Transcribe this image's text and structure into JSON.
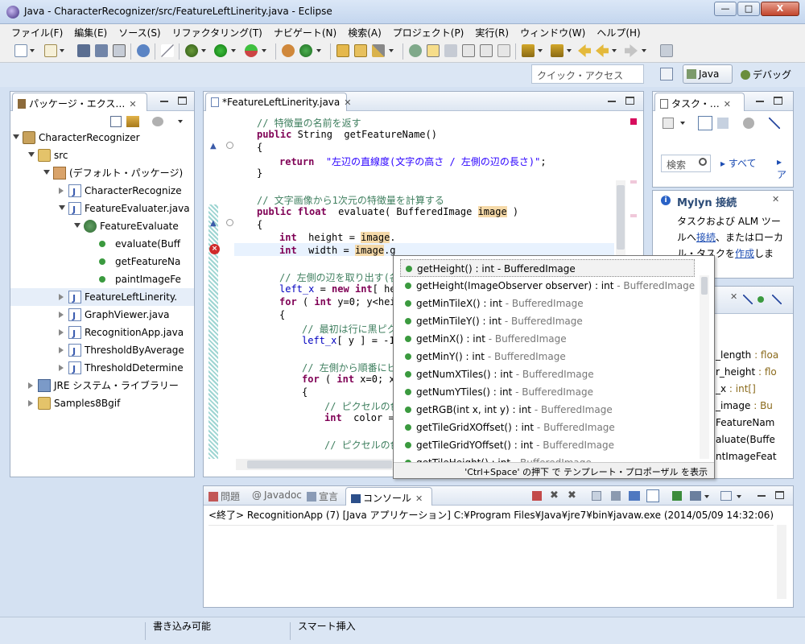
{
  "window": {
    "title": "Java - CharacterRecognizer/src/FeatureLeftLinerity.java - Eclipse",
    "min_btn": "—",
    "max_btn": "□",
    "close_btn": "X"
  },
  "menu": [
    "ファイル(F)",
    "編集(E)",
    "ソース(S)",
    "リファクタリング(T)",
    "ナビゲート(N)",
    "検索(A)",
    "プロジェクト(P)",
    "実行(R)",
    "ウィンドウ(W)",
    "ヘルプ(H)"
  ],
  "toolbar": {
    "quick_access": "クイック・アクセス",
    "perspective_java": "Java",
    "perspective_debug": "デバッグ"
  },
  "package_explorer": {
    "tab": "パッケージ・エクス…",
    "close": "✕",
    "tree": [
      {
        "label": "CharacterRecognizer",
        "type": "proj"
      },
      {
        "label": "src",
        "type": "folder"
      },
      {
        "label": "(デフォルト・パッケージ)",
        "type": "pkg"
      },
      {
        "label": "CharacterRecognize",
        "type": "file"
      },
      {
        "label": "FeatureEvaluater.java",
        "type": "file"
      },
      {
        "label": "FeatureEvaluate",
        "type": "class"
      },
      {
        "label": "evaluate(Buff",
        "type": "method"
      },
      {
        "label": "getFeatureNa",
        "type": "method"
      },
      {
        "label": "paintImageFe",
        "type": "method"
      },
      {
        "label": "FeatureLeftLinerity.",
        "type": "file"
      },
      {
        "label": "GraphViewer.java",
        "type": "file"
      },
      {
        "label": "RecognitionApp.java",
        "type": "file"
      },
      {
        "label": "ThresholdByAverage",
        "type": "file"
      },
      {
        "label": "ThresholdDetermine",
        "type": "file"
      },
      {
        "label": "JRE システム・ライブラリー",
        "type": "lib"
      },
      {
        "label": "Samples8Bgif",
        "type": "folder"
      }
    ]
  },
  "editor": {
    "tab": "*FeatureLeftLinerity.java",
    "close": "✕"
  },
  "code": [
    {
      "t": [
        [
          "cm",
          "// 特徴量の名前を返す"
        ]
      ],
      "indent": 1
    },
    {
      "t": [
        [
          "kw",
          "public"
        ],
        [
          "",
          " String  getFeatureName()"
        ]
      ],
      "indent": 1
    },
    {
      "t": [
        [
          "",
          "{"
        ]
      ],
      "indent": 1
    },
    {
      "t": [
        [
          "kw",
          "return"
        ],
        [
          "",
          "  "
        ],
        [
          "st",
          "\"左辺の直線度(文字の高さ / 左側の辺の長さ)\""
        ],
        [
          "",
          ";"
        ]
      ],
      "indent": 2
    },
    {
      "t": [
        [
          "",
          "}"
        ]
      ],
      "indent": 1
    },
    {
      "t": [],
      "indent": 0
    },
    {
      "t": [
        [
          "cm",
          "// 文字画像から1次元の特徴量を計算する"
        ]
      ],
      "indent": 1
    },
    {
      "t": [
        [
          "kw",
          "public"
        ],
        [
          "",
          " "
        ],
        [
          "kw",
          "float"
        ],
        [
          "",
          "  evaluate( BufferedImage "
        ],
        [
          "hl",
          "image"
        ],
        [
          "",
          " )"
        ]
      ],
      "indent": 1
    },
    {
      "t": [
        [
          "",
          "{"
        ]
      ],
      "indent": 1
    },
    {
      "t": [
        [
          "kw",
          "int"
        ],
        [
          "",
          "  height = "
        ],
        [
          "hl",
          "image"
        ],
        [
          "",
          "."
        ]
      ],
      "indent": 2
    },
    {
      "t": [
        [
          "kw",
          "int"
        ],
        [
          "",
          "  width = "
        ],
        [
          "hl",
          "image"
        ],
        [
          "",
          ".g"
        ]
      ],
      "indent": 2
    },
    {
      "t": [],
      "indent": 0
    },
    {
      "t": [
        [
          "cm",
          "// 左側の辺を取り出す(各)"
        ]
      ],
      "indent": 2
    },
    {
      "t": [
        [
          "fld",
          "left_x"
        ],
        [
          "",
          " = "
        ],
        [
          "kw",
          "new"
        ],
        [
          "",
          " "
        ],
        [
          "kw",
          "int"
        ],
        [
          "",
          "[ he"
        ]
      ],
      "indent": 2
    },
    {
      "t": [
        [
          "kw",
          "for"
        ],
        [
          "",
          " ( "
        ],
        [
          "kw",
          "int"
        ],
        [
          "",
          " y=0; y<hei"
        ]
      ],
      "indent": 2
    },
    {
      "t": [
        [
          "",
          "{"
        ]
      ],
      "indent": 2
    },
    {
      "t": [
        [
          "cm",
          "// 最初は行に黒ピクセ"
        ]
      ],
      "indent": 3
    },
    {
      "t": [
        [
          "fld",
          "left_x"
        ],
        [
          "",
          "[ y ] = -1"
        ]
      ],
      "indent": 3
    },
    {
      "t": [],
      "indent": 0
    },
    {
      "t": [
        [
          "cm",
          "// 左側から順番にピク"
        ]
      ],
      "indent": 3
    },
    {
      "t": [
        [
          "kw",
          "for"
        ],
        [
          "",
          " ( "
        ],
        [
          "kw",
          "int"
        ],
        [
          "",
          " x=0; x"
        ]
      ],
      "indent": 3
    },
    {
      "t": [
        [
          "",
          "{"
        ]
      ],
      "indent": 3
    },
    {
      "t": [
        [
          "cm",
          "// ピクセルの色を"
        ]
      ],
      "indent": 4
    },
    {
      "t": [
        [
          "kw",
          "int"
        ],
        [
          "",
          "  color ="
        ]
      ],
      "indent": 4
    },
    {
      "t": [],
      "indent": 0
    },
    {
      "t": [
        [
          "cm",
          "// ピクセルの色が"
        ]
      ],
      "indent": 4
    }
  ],
  "completion": {
    "items": [
      {
        "sig": "getHeight() : int",
        "type": "BufferedImage"
      },
      {
        "sig": "getHeight(ImageObserver observer) : int",
        "type": "BufferedImage"
      },
      {
        "sig": "getMinTileX() : int",
        "type": "BufferedImage"
      },
      {
        "sig": "getMinTileY() : int",
        "type": "BufferedImage"
      },
      {
        "sig": "getMinX() : int",
        "type": "BufferedImage"
      },
      {
        "sig": "getMinY() : int",
        "type": "BufferedImage"
      },
      {
        "sig": "getNumXTiles() : int",
        "type": "BufferedImage"
      },
      {
        "sig": "getNumYTiles() : int",
        "type": "BufferedImage"
      },
      {
        "sig": "getRGB(int x, int y) : int",
        "type": "BufferedImage"
      },
      {
        "sig": "getTileGridXOffset() : int",
        "type": "BufferedImage"
      },
      {
        "sig": "getTileGridYOffset() : int",
        "type": "BufferedImage"
      },
      {
        "sig": "getTileHeight() : int",
        "type": "BufferedImage"
      }
    ],
    "selected_index": 0,
    "footer": "'Ctrl+Space' の押下 で テンプレート・プロポーザル を表示"
  },
  "task_pane": {
    "tab": "タスク・…",
    "close": "✕",
    "search_label": "検索",
    "all_label": "すべて",
    "trunc_label": "ア"
  },
  "mylyn": {
    "title": "Mylyn 接続",
    "close": "✕",
    "line1": "タスクおよび ALM ツー",
    "line2_pre": "ルへ",
    "link1": "接続",
    "line2_post": "、またはローカ",
    "line3_pre": "ル・タスクを",
    "link2": "作成",
    "line3_post": "しま"
  },
  "outline": {
    "items": [
      {
        "name": "_length",
        "type": " : floa"
      },
      {
        "name": "r_height",
        "type": " : flo"
      },
      {
        "name": "_x",
        "type": " : int[]"
      },
      {
        "name": "_image",
        "type": " : Bu"
      },
      {
        "name": "FeatureNam",
        "type": ""
      },
      {
        "name": "aluate(Buffe",
        "type": ""
      },
      {
        "name": "ntImageFeat",
        "type": ""
      }
    ]
  },
  "bottom": {
    "tabs": [
      "問題",
      "Javadoc",
      "宣言",
      "コンソール"
    ],
    "close": "✕",
    "console_line": "<終了> RecognitionApp (7) [Java アプリケーション] C:¥Program Files¥Java¥jre7¥bin¥javaw.exe (2014/05/09 14:32:06)"
  },
  "status": {
    "writable": "書き込み可能",
    "insert_mode": "スマート挿入"
  }
}
